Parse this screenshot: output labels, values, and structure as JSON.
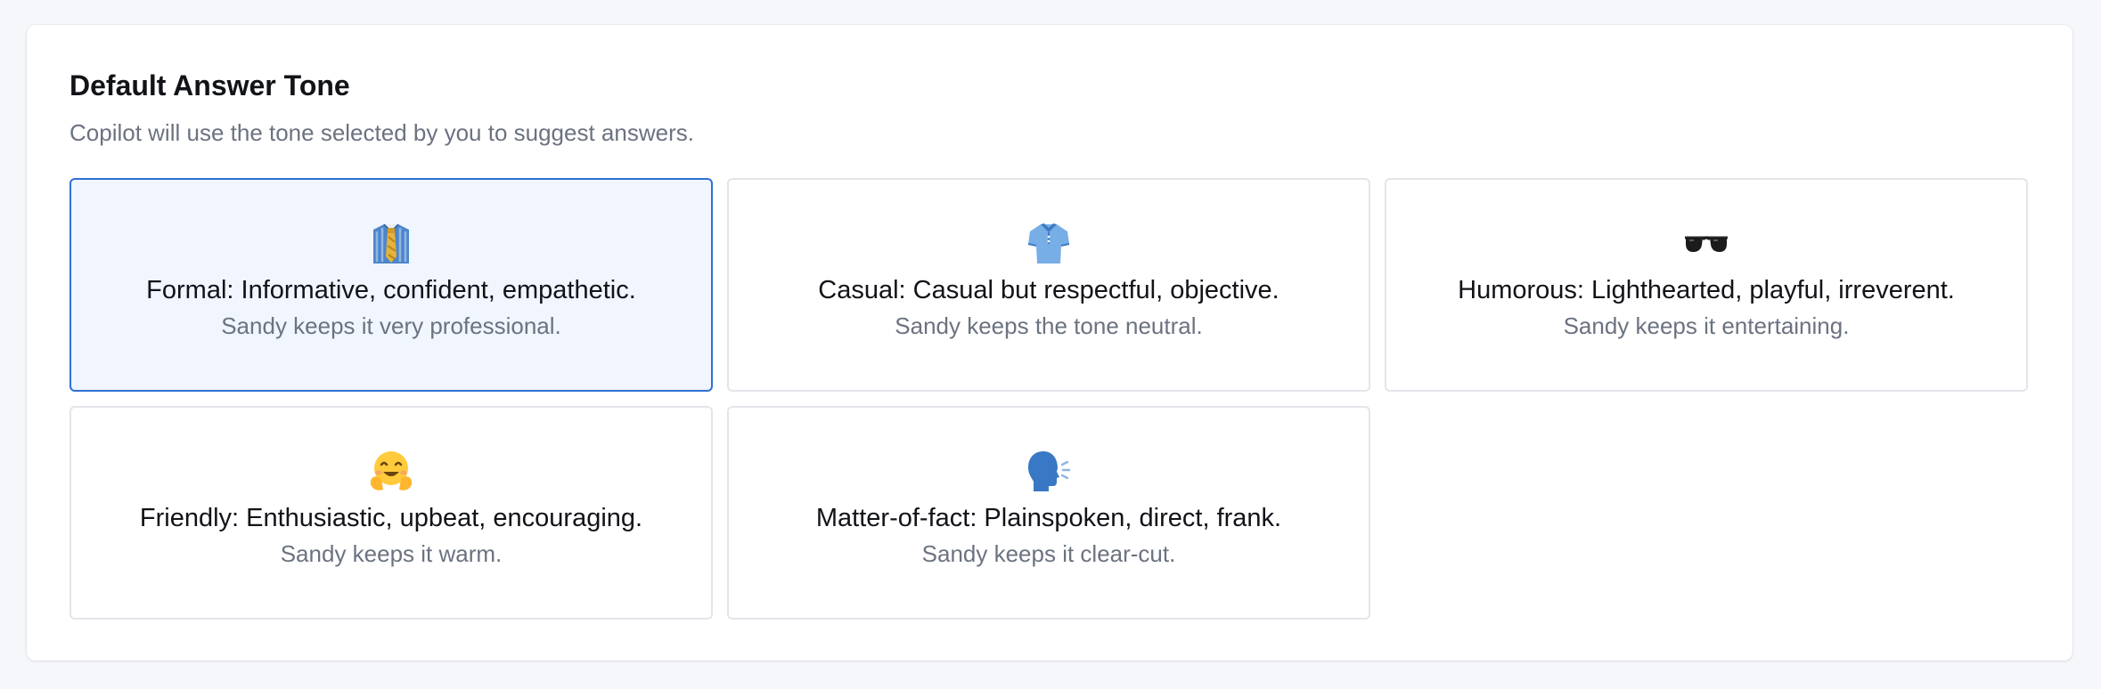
{
  "section": {
    "title": "Default Answer Tone",
    "subtitle": "Copilot will use the tone selected by you to suggest answers."
  },
  "selected_tone": "formal",
  "colors": {
    "accent": "#2f6fd3",
    "selected_bg": "#f0f5fe",
    "card_border": "#e3e5ea",
    "muted_text": "#6b7280"
  },
  "tones": [
    {
      "id": "formal",
      "icon": "necktie-shirt-icon",
      "title": "Formal: Informative, confident, empathetic.",
      "description": "Sandy keeps it very professional.",
      "selected": true
    },
    {
      "id": "casual",
      "icon": "polo-shirt-icon",
      "title": "Casual: Casual but respectful, objective.",
      "description": "Sandy keeps the tone neutral.",
      "selected": false
    },
    {
      "id": "humorous",
      "icon": "sunglasses-icon",
      "title": "Humorous: Lighthearted, playful, irreverent.",
      "description": "Sandy keeps it entertaining.",
      "selected": false
    },
    {
      "id": "friendly",
      "icon": "hugging-face-icon",
      "title": "Friendly: Enthusiastic, upbeat, encouraging.",
      "description": "Sandy keeps it warm.",
      "selected": false
    },
    {
      "id": "matter-of-fact",
      "icon": "speaking-head-icon",
      "title": "Matter-of-fact: Plainspoken, direct, frank.",
      "description": "Sandy keeps it clear-cut.",
      "selected": false
    }
  ]
}
